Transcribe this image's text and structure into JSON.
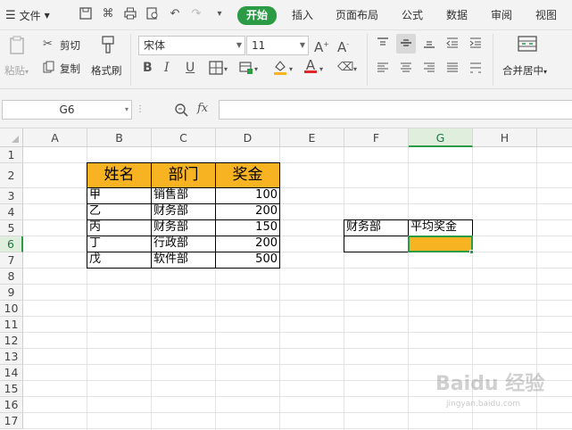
{
  "quick_access": {
    "file_label": "文件",
    "icons": [
      "save-icon",
      "format-painter-quick-icon",
      "print-icon",
      "print-preview-icon",
      "undo-icon",
      "redo-icon",
      "customize-icon"
    ]
  },
  "ribbon": {
    "tabs": [
      {
        "label": "开始",
        "active": true
      },
      {
        "label": "插入",
        "active": false
      },
      {
        "label": "页面布局",
        "active": false
      },
      {
        "label": "公式",
        "active": false
      },
      {
        "label": "数据",
        "active": false
      },
      {
        "label": "审阅",
        "active": false
      },
      {
        "label": "视图",
        "active": false
      }
    ]
  },
  "toolbar": {
    "paste_label": "粘贴",
    "cut_label": "剪切",
    "copy_label": "复制",
    "format_painter_label": "格式刷",
    "font_name": "宋体",
    "font_size": "11",
    "bold": "B",
    "italic": "I",
    "underline": "U",
    "merge_label": "合并居中",
    "accent_color": "#2b9b45",
    "font_color": "#e0262b",
    "fill_color": "#f8b323"
  },
  "formula_bar": {
    "name_box": "G6",
    "fx_label": "fx",
    "content": ""
  },
  "sheet": {
    "columns": [
      "A",
      "B",
      "C",
      "D",
      "E",
      "F",
      "G",
      "H"
    ],
    "rows": [
      "1",
      "2",
      "3",
      "4",
      "5",
      "6",
      "7",
      "8",
      "9",
      "10",
      "11",
      "12",
      "13",
      "14",
      "15",
      "16",
      "17"
    ],
    "selected_cell": "G6",
    "table": {
      "headers": [
        "姓名",
        "部门",
        "奖金"
      ],
      "rows": [
        [
          "甲",
          "销售部",
          "100"
        ],
        [
          "乙",
          "财务部",
          "200"
        ],
        [
          "丙",
          "财务部",
          "150"
        ],
        [
          "丁",
          "行政部",
          "200"
        ],
        [
          "戊",
          "软件部",
          "500"
        ]
      ],
      "header_fill": "#f8b323"
    },
    "criteria": {
      "F5": "财务部",
      "G5": "平均奖金",
      "F6": "",
      "G6": ""
    }
  },
  "watermark": "Baidu 经验"
}
